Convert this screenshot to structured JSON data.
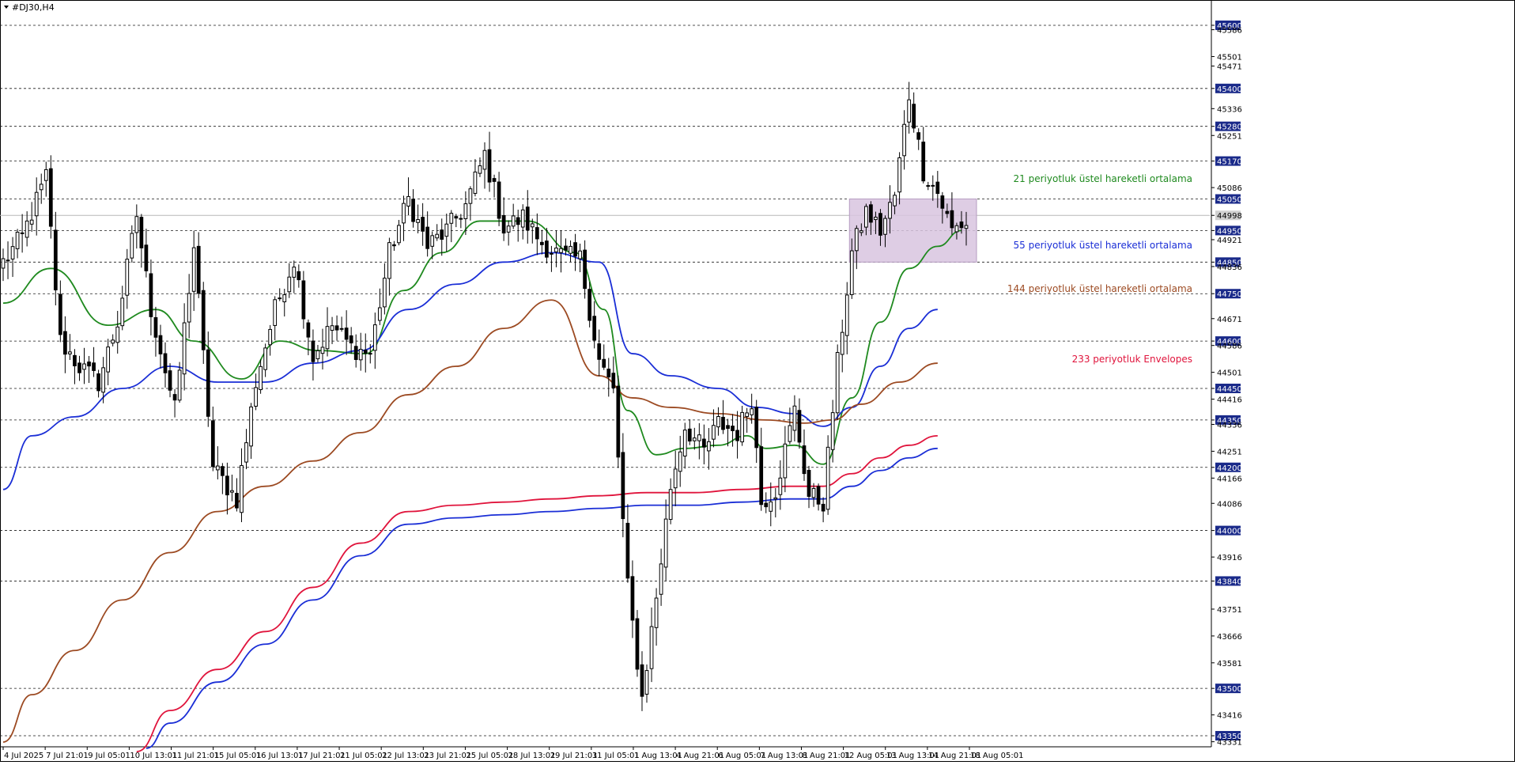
{
  "symbol": "#DJ30,H4",
  "colors": {
    "background": "#ffffff",
    "grid": "#1a1a1a",
    "candle_bull": "#ffffff",
    "candle_bear": "#000000",
    "ema21": "#1f8a1f",
    "ema55": "#1a2ed6",
    "ema144": "#9c4a22",
    "env_upper": "#e0143c",
    "env_lower": "#1a2ed6",
    "highlight_box": "#d8c4df",
    "price_box": "#1a2a8a"
  },
  "chart_data": {
    "type": "candlestick",
    "title": "#DJ30,H4",
    "ylim": [
      43320,
      45640
    ],
    "current_price": "44998",
    "y_ticks": [
      "45600",
      "45586",
      "45501",
      "45471",
      "45400",
      "45336",
      "45280",
      "45251",
      "45170",
      "45086",
      "45050",
      "44998",
      "44950",
      "44921",
      "44850",
      "44836",
      "44750",
      "44671",
      "44600",
      "44586",
      "44501",
      "44450",
      "44416",
      "44350",
      "44336",
      "44251",
      "44200",
      "44166",
      "44086",
      "44000",
      "43916",
      "43840",
      "43751",
      "43666",
      "43581",
      "43500",
      "43416",
      "43350",
      "43331"
    ],
    "h_levels": [
      45600,
      45400,
      45280,
      45170,
      45050,
      44950,
      44850,
      44750,
      44600,
      44450,
      44350,
      44200,
      44000,
      43840,
      43500,
      43350
    ],
    "highlighted_ticks": [
      "45600",
      "45400",
      "45280",
      "45170",
      "45050",
      "44950",
      "44850",
      "44750",
      "44600",
      "44450",
      "44350",
      "44200",
      "44000",
      "43840",
      "43500",
      "43350",
      "44998"
    ],
    "x_ticks": [
      "4 Jul 2025",
      "7 Jul 21:01",
      "9 Jul 05:01",
      "10 Jul 13:01",
      "11 Jul 21:01",
      "15 Jul 05:01",
      "16 Jul 13:01",
      "17 Jul 21:01",
      "21 Jul 05:01",
      "22 Jul 13:01",
      "23 Jul 21:01",
      "25 Jul 05:01",
      "28 Jul 13:01",
      "29 Jul 21:01",
      "31 Jul 05:01",
      "1 Aug 13:01",
      "4 Aug 21:01",
      "6 Aug 05:01",
      "7 Aug 13:01",
      "8 Aug 21:01",
      "12 Aug 05:01",
      "13 Aug 13:01",
      "14 Aug 21:01",
      "18 Aug 05:01"
    ],
    "ohlc_keypoints": [
      [
        0,
        44850
      ],
      [
        4,
        44930
      ],
      [
        9,
        45120
      ],
      [
        12,
        44600
      ],
      [
        16,
        44520
      ],
      [
        20,
        44470
      ],
      [
        24,
        44660
      ],
      [
        28,
        45000
      ],
      [
        31,
        44700
      ],
      [
        36,
        44380
      ],
      [
        40,
        44900
      ],
      [
        44,
        44200
      ],
      [
        49,
        44100
      ],
      [
        53,
        44470
      ],
      [
        57,
        44700
      ],
      [
        61,
        44860
      ],
      [
        65,
        44550
      ],
      [
        69,
        44650
      ],
      [
        73,
        44580
      ],
      [
        77,
        44560
      ],
      [
        81,
        44880
      ],
      [
        85,
        45050
      ],
      [
        89,
        44900
      ],
      [
        93,
        44950
      ],
      [
        97,
        45030
      ],
      [
        101,
        45190
      ],
      [
        105,
        44960
      ],
      [
        109,
        44990
      ],
      [
        113,
        44910
      ],
      [
        117,
        44870
      ],
      [
        121,
        44860
      ],
      [
        125,
        44540
      ],
      [
        128,
        44440
      ],
      [
        131,
        43820
      ],
      [
        134,
        43470
      ],
      [
        137,
        43790
      ],
      [
        140,
        44140
      ],
      [
        143,
        44330
      ],
      [
        147,
        44250
      ],
      [
        150,
        44340
      ],
      [
        154,
        44310
      ],
      [
        157,
        44420
      ],
      [
        159,
        44090
      ],
      [
        162,
        44130
      ],
      [
        166,
        44380
      ],
      [
        169,
        44110
      ],
      [
        172,
        44090
      ],
      [
        175,
        44530
      ],
      [
        178,
        44880
      ],
      [
        181,
        45010
      ],
      [
        184,
        44950
      ],
      [
        187,
        45060
      ],
      [
        190,
        45380
      ],
      [
        193,
        45140
      ],
      [
        196,
        45070
      ],
      [
        199,
        44950
      ],
      [
        201,
        44970
      ]
    ],
    "series": [
      {
        "name": "21 periyotluk üstel hareketli ortalama",
        "key": "ema21",
        "values": [
          [
            0,
            44720
          ],
          [
            10,
            44830
          ],
          [
            22,
            44650
          ],
          [
            32,
            44700
          ],
          [
            40,
            44600
          ],
          [
            50,
            44480
          ],
          [
            58,
            44600
          ],
          [
            66,
            44570
          ],
          [
            76,
            44560
          ],
          [
            84,
            44760
          ],
          [
            92,
            44880
          ],
          [
            100,
            44980
          ],
          [
            110,
            44980
          ],
          [
            120,
            44880
          ],
          [
            126,
            44700
          ],
          [
            131,
            44380
          ],
          [
            137,
            44240
          ],
          [
            143,
            44260
          ],
          [
            150,
            44270
          ],
          [
            156,
            44300
          ],
          [
            160,
            44260
          ],
          [
            166,
            44270
          ],
          [
            172,
            44210
          ],
          [
            178,
            44420
          ],
          [
            184,
            44660
          ],
          [
            190,
            44830
          ],
          [
            196,
            44900
          ],
          [
            201,
            44950
          ]
        ]
      },
      {
        "name": "55 periyotluk üstel hareketli ortalama",
        "key": "ema55",
        "values": [
          [
            0,
            44130
          ],
          [
            6,
            44300
          ],
          [
            15,
            44360
          ],
          [
            25,
            44450
          ],
          [
            35,
            44520
          ],
          [
            45,
            44470
          ],
          [
            55,
            44470
          ],
          [
            65,
            44530
          ],
          [
            75,
            44570
          ],
          [
            85,
            44700
          ],
          [
            95,
            44780
          ],
          [
            105,
            44850
          ],
          [
            115,
            44880
          ],
          [
            125,
            44850
          ],
          [
            132,
            44560
          ],
          [
            140,
            44490
          ],
          [
            150,
            44450
          ],
          [
            158,
            44390
          ],
          [
            166,
            44370
          ],
          [
            172,
            44330
          ],
          [
            178,
            44390
          ],
          [
            184,
            44520
          ],
          [
            190,
            44640
          ],
          [
            196,
            44700
          ]
        ]
      },
      {
        "name": "144 periyotluk üstel hareketli ortalama",
        "key": "ema144",
        "values": [
          [
            0,
            43330
          ],
          [
            6,
            43480
          ],
          [
            15,
            43620
          ],
          [
            25,
            43780
          ],
          [
            35,
            43930
          ],
          [
            45,
            44060
          ],
          [
            55,
            44140
          ],
          [
            65,
            44220
          ],
          [
            75,
            44310
          ],
          [
            85,
            44430
          ],
          [
            95,
            44520
          ],
          [
            105,
            44640
          ],
          [
            115,
            44730
          ],
          [
            125,
            44490
          ],
          [
            132,
            44420
          ],
          [
            140,
            44390
          ],
          [
            150,
            44370
          ],
          [
            160,
            44350
          ],
          [
            168,
            44340
          ],
          [
            174,
            44350
          ],
          [
            180,
            44400
          ],
          [
            188,
            44470
          ],
          [
            196,
            44530
          ]
        ]
      },
      {
        "name": "233 periyotluk Envelopes",
        "key": "env_upper",
        "values": [
          [
            28,
            43300
          ],
          [
            35,
            43430
          ],
          [
            45,
            43560
          ],
          [
            55,
            43680
          ],
          [
            65,
            43820
          ],
          [
            75,
            43960
          ],
          [
            85,
            44060
          ],
          [
            95,
            44080
          ],
          [
            105,
            44090
          ],
          [
            115,
            44100
          ],
          [
            125,
            44110
          ],
          [
            135,
            44120
          ],
          [
            145,
            44120
          ],
          [
            155,
            44130
          ],
          [
            165,
            44140
          ],
          [
            172,
            44140
          ],
          [
            178,
            44180
          ],
          [
            184,
            44230
          ],
          [
            190,
            44270
          ],
          [
            196,
            44300
          ]
        ]
      },
      {
        "name": "",
        "key": "env_lower",
        "values": [
          [
            30,
            43310
          ],
          [
            35,
            43390
          ],
          [
            45,
            43520
          ],
          [
            55,
            43640
          ],
          [
            65,
            43780
          ],
          [
            75,
            43920
          ],
          [
            85,
            44020
          ],
          [
            95,
            44040
          ],
          [
            105,
            44050
          ],
          [
            115,
            44060
          ],
          [
            125,
            44070
          ],
          [
            135,
            44080
          ],
          [
            145,
            44080
          ],
          [
            155,
            44090
          ],
          [
            165,
            44100
          ],
          [
            172,
            44100
          ],
          [
            178,
            44140
          ],
          [
            184,
            44190
          ],
          [
            190,
            44230
          ],
          [
            196,
            44260
          ]
        ]
      }
    ],
    "zone": {
      "from_index": 178,
      "to_index": 202,
      "low": 44850,
      "high": 45050
    }
  }
}
